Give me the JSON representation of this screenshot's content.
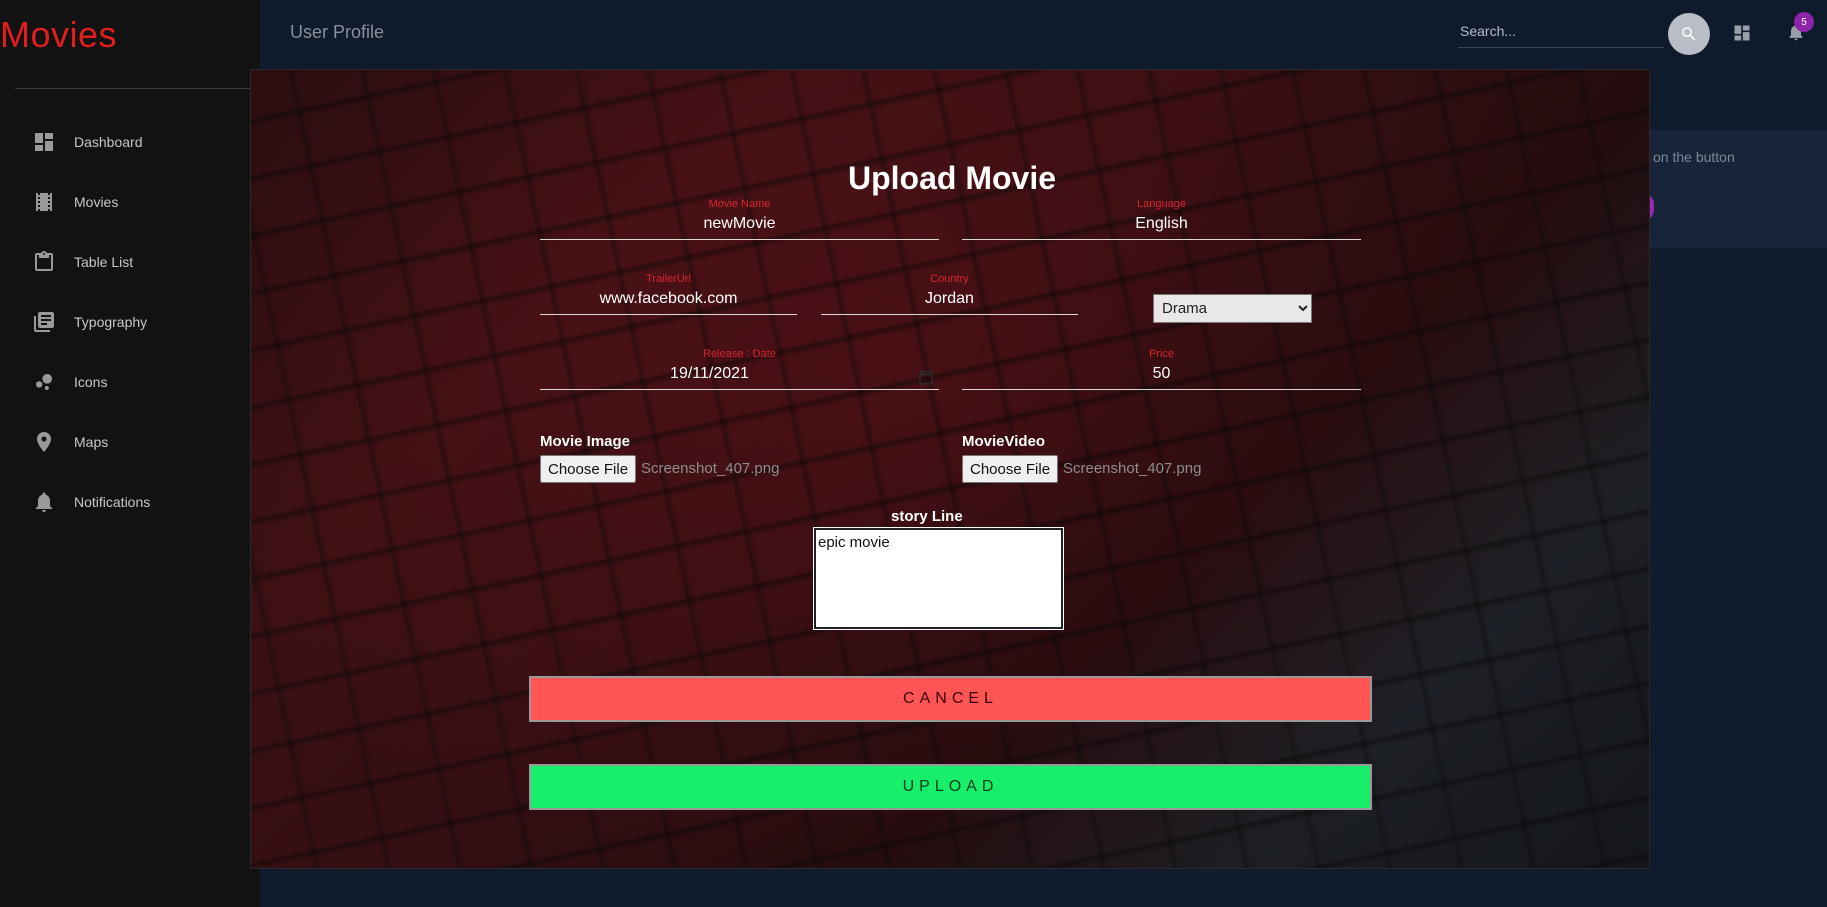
{
  "sidebar": {
    "brand": "Movies",
    "items": [
      {
        "label": "Dashboard",
        "icon": "dashboard-icon"
      },
      {
        "label": "Movies",
        "icon": "film-icon"
      },
      {
        "label": "Table List",
        "icon": "clipboard-icon"
      },
      {
        "label": "Typography",
        "icon": "library-books-icon"
      },
      {
        "label": "Icons",
        "icon": "bubble-chart-icon"
      },
      {
        "label": "Maps",
        "icon": "location-pin-icon"
      },
      {
        "label": "Notifications",
        "icon": "bell-icon"
      }
    ]
  },
  "header": {
    "title": "User Profile",
    "search_placeholder": "Search...",
    "notification_count": "5"
  },
  "background_card": {
    "text": "on the button"
  },
  "modal": {
    "title": "Upload Movie",
    "fields": {
      "movie_name": {
        "label": "Movie Name",
        "value": "newMovie"
      },
      "language": {
        "label": "Language",
        "value": "English"
      },
      "trailer_url": {
        "label": "TrailerUrl",
        "value": "www.facebook.com"
      },
      "country": {
        "label": "Country",
        "value": "Jordan"
      },
      "release_date": {
        "label": "Release : Date",
        "value": "19/11/2021"
      },
      "price": {
        "label": "Price",
        "value": "50"
      }
    },
    "genre": {
      "selected": "Drama"
    },
    "movie_image": {
      "label": "Movie Image",
      "button": "Choose File",
      "file": "Screenshot_407.png"
    },
    "movie_video": {
      "label": "MovieVideo",
      "button": "Choose File",
      "file": "Screenshot_407.png"
    },
    "story_line": {
      "label": "story Line",
      "value": "epic movie "
    },
    "cancel_label": "CANCEL",
    "upload_label": "UPLOAD"
  },
  "colors": {
    "brand": "#e11d1d",
    "field_label": "#d9262f",
    "cancel": "#ff5555",
    "upload": "#17ef6b",
    "badge": "#8e24aa"
  }
}
